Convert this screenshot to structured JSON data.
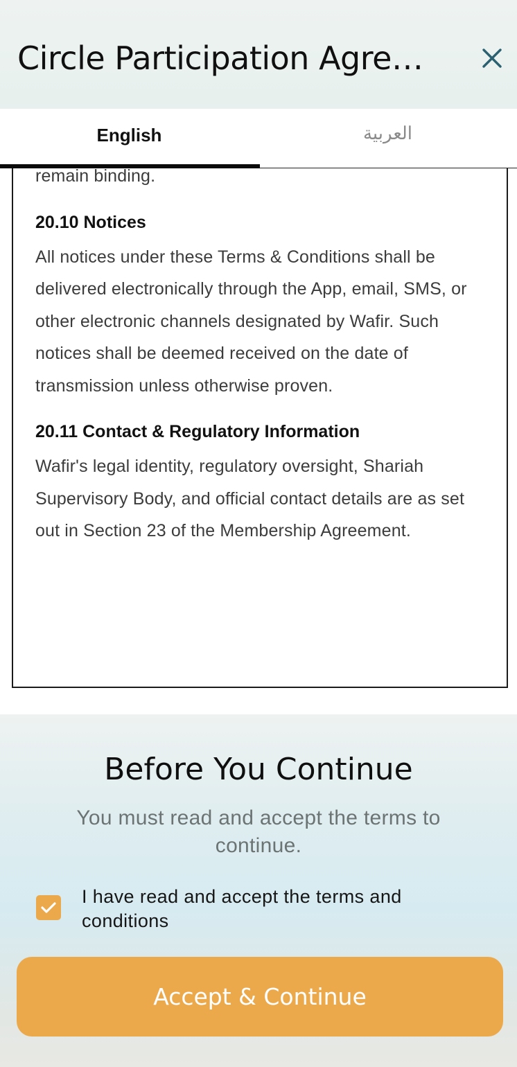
{
  "header": {
    "title": "Circle Participation Agreement",
    "close_icon": "close-icon"
  },
  "tabs": [
    {
      "label": "English",
      "active": true
    },
    {
      "label": "العربية",
      "active": false
    }
  ],
  "document": {
    "fragment": "remain binding.",
    "sections": [
      {
        "heading": "20.10 Notices",
        "body": "All notices under these Terms & Conditions shall be delivered electronically through the App, email, SMS, or other electronic channels designated by Wafir. Such notices shall be deemed received on the date of transmission unless otherwise proven."
      },
      {
        "heading": "20.11 Contact & Regulatory Information",
        "body": "Wafir's legal identity, regulatory oversight, Shariah Supervisory Body, and official contact details are as set out in Section 23 of the Membership Agreement."
      }
    ]
  },
  "consent": {
    "title": "Before You Continue",
    "subtitle": "You must read and accept the terms to continue.",
    "checkbox_label": "I have read and accept the terms and conditions",
    "checkbox_checked": true,
    "button_label": "Accept & Continue"
  },
  "colors": {
    "accent": "#eca94b",
    "close_icon": "#2b6070",
    "title": "#101010",
    "subtitle": "#6b7373"
  }
}
